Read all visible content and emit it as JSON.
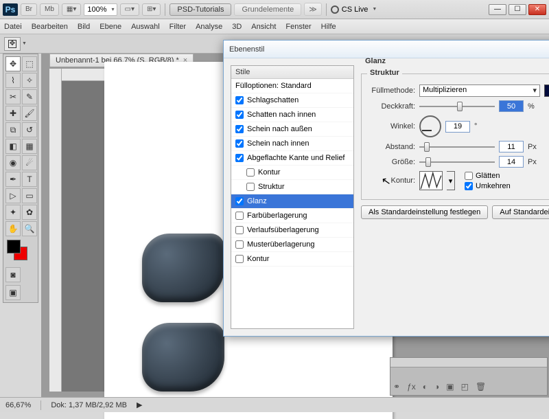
{
  "app": {
    "zoom_select": "100%",
    "ws1": "PSD-Tutorials",
    "ws2": "Grundelemente",
    "cslive": "CS Live"
  },
  "menu": [
    "Datei",
    "Bearbeiten",
    "Bild",
    "Ebene",
    "Auswahl",
    "Filter",
    "Analyse",
    "3D",
    "Ansicht",
    "Fenster",
    "Hilfe"
  ],
  "doc": {
    "tab": "Unbenannt-1 bei 66,7% (S, RGB/8) *"
  },
  "status": {
    "zoom": "66,67%",
    "dok": "Dok: 1,37 MB/2,92 MB"
  },
  "dialog": {
    "title": "Ebenenstil",
    "styles_header": "Stile",
    "styles": [
      {
        "label": "Fülloptionen: Standard",
        "checked": null
      },
      {
        "label": "Schlagschatten",
        "checked": true
      },
      {
        "label": "Schatten nach innen",
        "checked": true
      },
      {
        "label": "Schein nach außen",
        "checked": true
      },
      {
        "label": "Schein nach innen",
        "checked": true
      },
      {
        "label": "Abgeflachte Kante und Relief",
        "checked": true
      },
      {
        "label": "Kontur",
        "checked": false,
        "indent": true
      },
      {
        "label": "Struktur",
        "checked": false,
        "indent": true
      },
      {
        "label": "Glanz",
        "checked": true,
        "selected": true
      },
      {
        "label": "Farbüberlagerung",
        "checked": false
      },
      {
        "label": "Verlaufsüberlagerung",
        "checked": false
      },
      {
        "label": "Musterüberlagerung",
        "checked": false
      },
      {
        "label": "Kontur",
        "checked": false
      }
    ],
    "panel_title": "Glanz",
    "group_title": "Struktur",
    "fields": {
      "fullmethode_lbl": "Füllmethode:",
      "fullmethode_val": "Multiplizieren",
      "deckkraft_lbl": "Deckkraft:",
      "deckkraft_val": "50",
      "deckkraft_unit": "%",
      "winkel_lbl": "Winkel:",
      "winkel_val": "19",
      "winkel_unit": "°",
      "abstand_lbl": "Abstand:",
      "abstand_val": "11",
      "abstand_unit": "Px",
      "groesse_lbl": "Größe:",
      "groesse_val": "14",
      "groesse_unit": "Px",
      "kontur_lbl": "Kontur:",
      "glaetten": "Glätten",
      "umkehren": "Umkehren"
    },
    "btn_default": "Als Standardeinstellung festlegen",
    "btn_reset": "Auf Standardeinst"
  }
}
